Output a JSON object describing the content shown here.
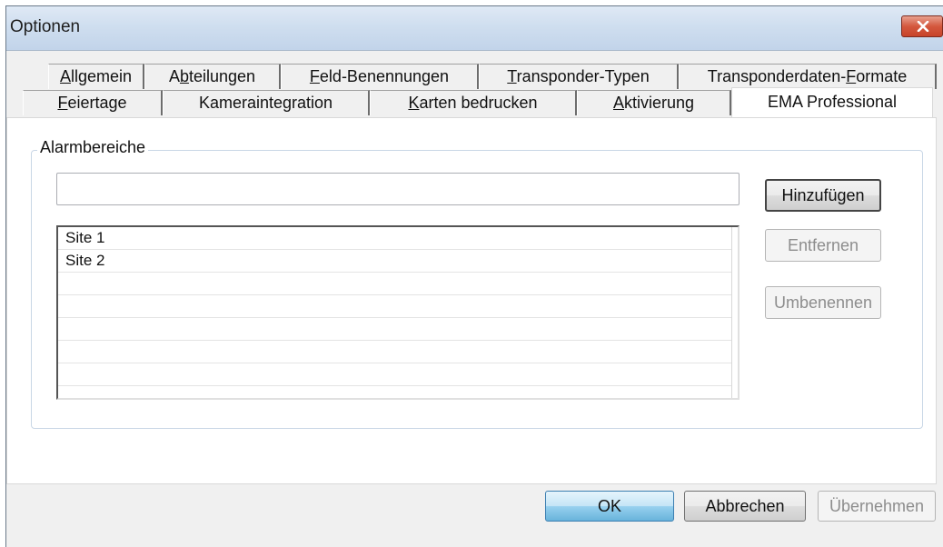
{
  "window": {
    "title": "Optionen"
  },
  "tabs_row1": [
    {
      "pre": "",
      "u": "A",
      "post": "llgemein"
    },
    {
      "pre": "A",
      "u": "b",
      "post": "teilungen"
    },
    {
      "pre": "",
      "u": "F",
      "post": "eld-Benennungen"
    },
    {
      "pre": "",
      "u": "T",
      "post": "ransponder-Typen"
    },
    {
      "pre": "Transponderdaten-",
      "u": "F",
      "post": "ormate"
    }
  ],
  "tabs_row2": [
    {
      "pre": "",
      "u": "F",
      "post": "eiertage"
    },
    {
      "pre": "Kameraintegration",
      "u": "",
      "post": ""
    },
    {
      "pre": "",
      "u": "K",
      "post": "arten bedrucken"
    },
    {
      "pre": "",
      "u": "A",
      "post": "ktivierung"
    },
    {
      "pre": "EMA Professional",
      "u": "",
      "post": ""
    }
  ],
  "group": {
    "label": "Alarmbereiche"
  },
  "input": {
    "value": ""
  },
  "list": {
    "items": [
      "Site 1",
      "Site 2"
    ]
  },
  "side_buttons": {
    "add": "Hinzufügen",
    "remove": "Entfernen",
    "rename": "Umbenennen"
  },
  "footer": {
    "ok": "OK",
    "cancel": "Abbrechen",
    "apply": "Übernehmen"
  }
}
